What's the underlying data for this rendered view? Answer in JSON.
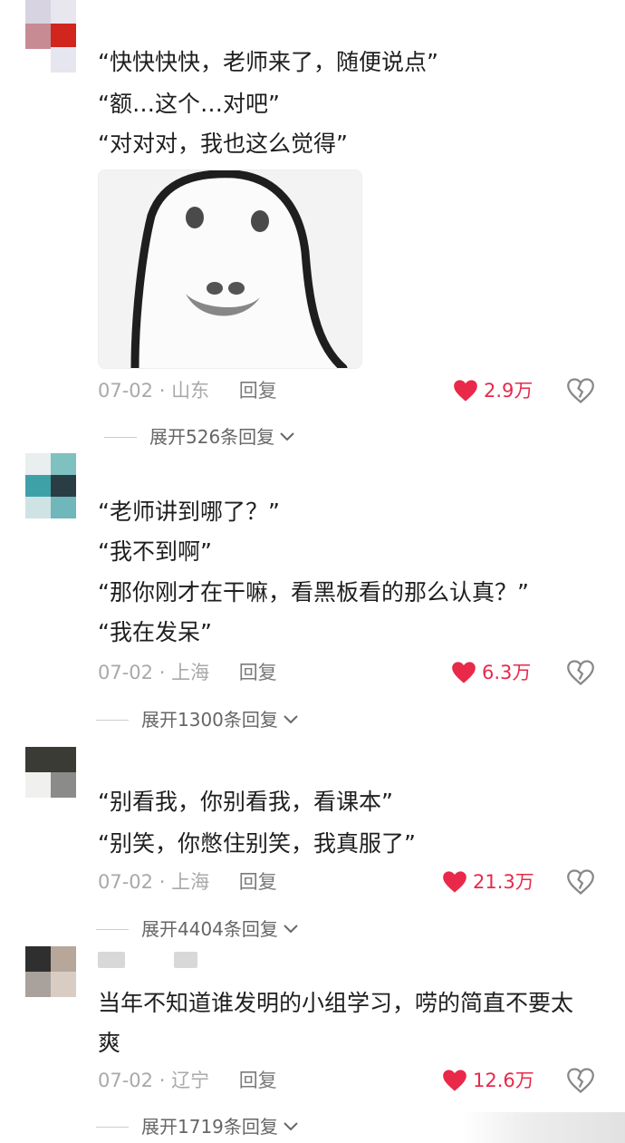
{
  "comments": [
    {
      "lines": [
        "“快快快快，老师来了，随便说点”",
        "“额…这个…对吧”",
        "“对对对，我也这么觉得”"
      ],
      "has_image": true,
      "image_icon": "blob-face-meme",
      "date": "07-02",
      "location": "山东",
      "reply_label": "回复",
      "likes": "2.9万",
      "expand": "展开526条回复"
    },
    {
      "lines": [
        "“老师讲到哪了？”",
        "“我不到啊”",
        "“那你刚才在干嘛，看黑板看的那么认真？”",
        "“我在发呆”"
      ],
      "has_image": false,
      "date": "07-02",
      "location": "上海",
      "reply_label": "回复",
      "likes": "6.3万",
      "expand": "展开1300条回复"
    },
    {
      "lines": [
        "“别看我，你别看我，看课本”",
        "“别笑，你憋住别笑，我真服了”"
      ],
      "has_image": false,
      "date": "07-02",
      "location": "上海",
      "reply_label": "回复",
      "likes": "21.3万",
      "expand": "展开4404条回复"
    },
    {
      "lines": [
        "当年不知道谁发明的小组学习，唠的简直不要太",
        "爽"
      ],
      "has_image": false,
      "date": "07-02",
      "location": "辽宁",
      "reply_label": "回复",
      "likes": "12.6万",
      "expand": "展开1719条回复"
    }
  ],
  "colors": {
    "like": "#e8294a",
    "meta": "#a9a9a9",
    "text": "#1f1f1f"
  },
  "icons": {
    "like": "heart-icon",
    "dislike": "broken-heart-icon",
    "expand": "chevron-down-icon"
  }
}
